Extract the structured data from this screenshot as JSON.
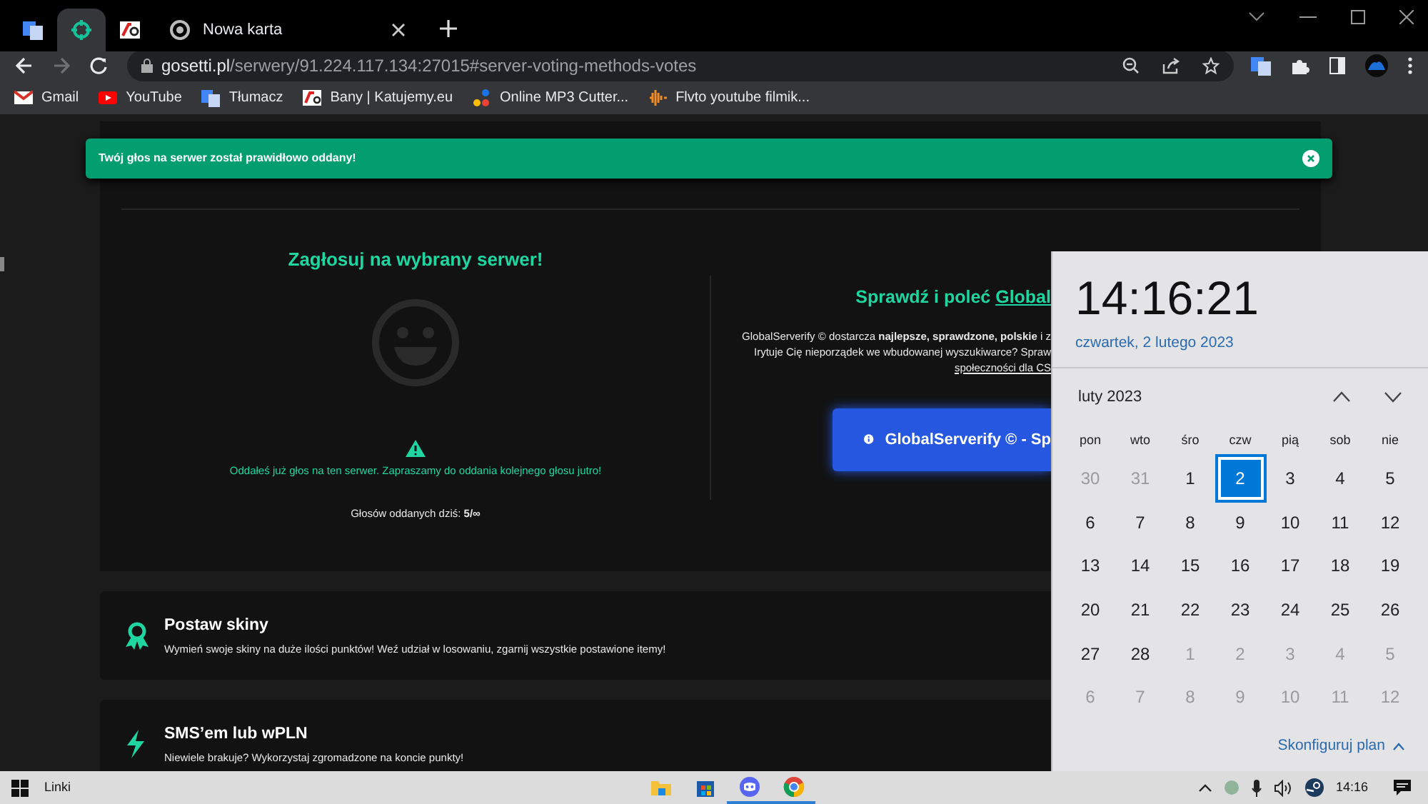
{
  "browser": {
    "tabs": [
      {
        "kind": "pinned",
        "selected": false
      },
      {
        "kind": "pinned",
        "selected": true
      },
      {
        "kind": "pinned",
        "selected": false
      },
      {
        "kind": "page",
        "title": "Nowa karta",
        "selected": false
      }
    ],
    "forward_enabled": false,
    "address": {
      "host": "gosetti.pl",
      "path": "/serwery/91.224.117.134:27015#server-voting-methods-votes"
    },
    "bookmarks": [
      "Gmail",
      "YouTube",
      "Tłumacz",
      "Bany | Katujemy.eu",
      "Online MP3 Cutter...",
      "Flvto youtube filmik..."
    ]
  },
  "toast": {
    "message": "Twój głos na serwer został prawidłowo oddany!"
  },
  "vote": {
    "title": "Zagłosuj na wybrany serwer!",
    "warning": "Oddałeś już głos na ten serwer. Zapraszamy do oddania kolejnego głosu jutro!",
    "count": "Głosów oddanych dziś: **5/∞**"
  },
  "promo": {
    "title": "Sprawdź i poleć ",
    "title_link": "Global",
    "lines": [
      "GlobalServerify © dostarcza **najlepsze, sprawdzone, polskie** i z",
      "Irytuje Cię nieporządek we wbudowanej wyszukiwarce? Spraw"
    ],
    "link": "społeczności dla CS",
    "button": "GlobalServerify © - Sp"
  },
  "features": [
    {
      "title": "Postaw skiny",
      "description": "Wymień swoje skiny na duże ilości punktów! Weź udział w losowaniu, zgarnij wszystkie postawione itemy!"
    },
    {
      "title": "SMS’em lub wPLN",
      "description": "Niewiele brakuje? Wykorzystaj zgromadzone na koncie punkty!"
    }
  ],
  "calendar": {
    "time": "14:16:21",
    "date": "czwartek, 2 lutego 2023",
    "month": "luty 2023",
    "weekdays": [
      "pon",
      "wto",
      "śro",
      "czw",
      "pią",
      "sob",
      "nie"
    ],
    "weeks": [
      [
        {
          "day": "30",
          "muted": true,
          "selected": false
        },
        {
          "day": "31",
          "muted": true,
          "selected": false
        },
        {
          "day": "1",
          "muted": false,
          "selected": false
        },
        {
          "day": "2",
          "muted": false,
          "selected": true
        },
        {
          "day": "3",
          "muted": false,
          "selected": false
        },
        {
          "day": "4",
          "muted": false,
          "selected": false
        },
        {
          "day": "5",
          "muted": false,
          "selected": false
        }
      ],
      [
        {
          "day": "6",
          "muted": false,
          "selected": false
        },
        {
          "day": "7",
          "muted": false,
          "selected": false
        },
        {
          "day": "8",
          "muted": false,
          "selected": false
        },
        {
          "day": "9",
          "muted": false,
          "selected": false
        },
        {
          "day": "10",
          "muted": false,
          "selected": false
        },
        {
          "day": "11",
          "muted": false,
          "selected": false
        },
        {
          "day": "12",
          "muted": false,
          "selected": false
        }
      ],
      [
        {
          "day": "13",
          "muted": false,
          "selected": false
        },
        {
          "day": "14",
          "muted": false,
          "selected": false
        },
        {
          "day": "15",
          "muted": false,
          "selected": false
        },
        {
          "day": "16",
          "muted": false,
          "selected": false
        },
        {
          "day": "17",
          "muted": false,
          "selected": false
        },
        {
          "day": "18",
          "muted": false,
          "selected": false
        },
        {
          "day": "19",
          "muted": false,
          "selected": false
        }
      ],
      [
        {
          "day": "20",
          "muted": false,
          "selected": false
        },
        {
          "day": "21",
          "muted": false,
          "selected": false
        },
        {
          "day": "22",
          "muted": false,
          "selected": false
        },
        {
          "day": "23",
          "muted": false,
          "selected": false
        },
        {
          "day": "24",
          "muted": false,
          "selected": false
        },
        {
          "day": "25",
          "muted": false,
          "selected": false
        },
        {
          "day": "26",
          "muted": false,
          "selected": false
        }
      ],
      [
        {
          "day": "27",
          "muted": false,
          "selected": false
        },
        {
          "day": "28",
          "muted": false,
          "selected": false
        },
        {
          "day": "1",
          "muted": true,
          "selected": false
        },
        {
          "day": "2",
          "muted": true,
          "selected": false
        },
        {
          "day": "3",
          "muted": true,
          "selected": false
        },
        {
          "day": "4",
          "muted": true,
          "selected": false
        },
        {
          "day": "5",
          "muted": true,
          "selected": false
        }
      ],
      [
        {
          "day": "6",
          "muted": true,
          "selected": false
        },
        {
          "day": "7",
          "muted": true,
          "selected": false
        },
        {
          "day": "8",
          "muted": true,
          "selected": false
        },
        {
          "day": "9",
          "muted": true,
          "selected": false
        },
        {
          "day": "10",
          "muted": true,
          "selected": false
        },
        {
          "day": "11",
          "muted": true,
          "selected": false
        },
        {
          "day": "12",
          "muted": true,
          "selected": false
        }
      ]
    ],
    "footer": "Skonfiguruj plan"
  },
  "taskbar": {
    "search": "Linki",
    "apps": [
      {
        "active": false
      },
      {
        "active": false
      },
      {
        "active": true
      },
      {
        "active": true
      }
    ],
    "clock": "14:16"
  }
}
